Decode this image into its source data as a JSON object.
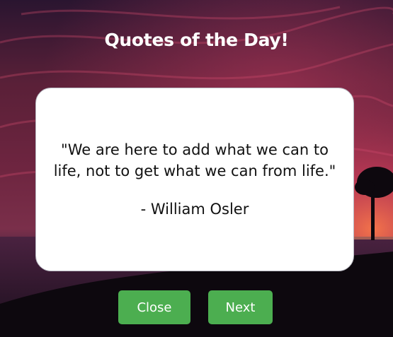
{
  "header": {
    "title": "Quotes of the Day!"
  },
  "quote": {
    "text": "\"We are here to add what we can to life, not to get what we can from life.\"",
    "author": "- William Osler"
  },
  "buttons": {
    "close_label": "Close",
    "next_label": "Next"
  },
  "colors": {
    "button": "#4cae50",
    "card": "#ffffff",
    "title": "#ffffff"
  }
}
